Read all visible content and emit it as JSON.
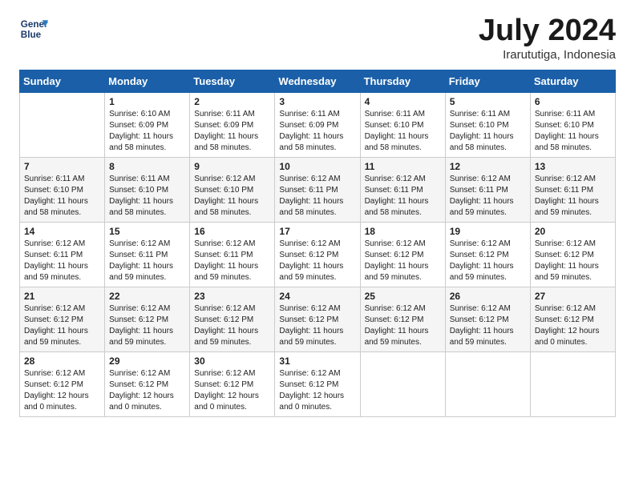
{
  "header": {
    "logo_line1": "General",
    "logo_line2": "Blue",
    "month": "July 2024",
    "location": "Irarututiga, Indonesia"
  },
  "weekdays": [
    "Sunday",
    "Monday",
    "Tuesday",
    "Wednesday",
    "Thursday",
    "Friday",
    "Saturday"
  ],
  "weeks": [
    [
      {
        "num": "",
        "info": ""
      },
      {
        "num": "1",
        "info": "Sunrise: 6:10 AM\nSunset: 6:09 PM\nDaylight: 11 hours\nand 58 minutes."
      },
      {
        "num": "2",
        "info": "Sunrise: 6:11 AM\nSunset: 6:09 PM\nDaylight: 11 hours\nand 58 minutes."
      },
      {
        "num": "3",
        "info": "Sunrise: 6:11 AM\nSunset: 6:09 PM\nDaylight: 11 hours\nand 58 minutes."
      },
      {
        "num": "4",
        "info": "Sunrise: 6:11 AM\nSunset: 6:10 PM\nDaylight: 11 hours\nand 58 minutes."
      },
      {
        "num": "5",
        "info": "Sunrise: 6:11 AM\nSunset: 6:10 PM\nDaylight: 11 hours\nand 58 minutes."
      },
      {
        "num": "6",
        "info": "Sunrise: 6:11 AM\nSunset: 6:10 PM\nDaylight: 11 hours\nand 58 minutes."
      }
    ],
    [
      {
        "num": "7",
        "info": "Sunrise: 6:11 AM\nSunset: 6:10 PM\nDaylight: 11 hours\nand 58 minutes."
      },
      {
        "num": "8",
        "info": "Sunrise: 6:11 AM\nSunset: 6:10 PM\nDaylight: 11 hours\nand 58 minutes."
      },
      {
        "num": "9",
        "info": "Sunrise: 6:12 AM\nSunset: 6:10 PM\nDaylight: 11 hours\nand 58 minutes."
      },
      {
        "num": "10",
        "info": "Sunrise: 6:12 AM\nSunset: 6:11 PM\nDaylight: 11 hours\nand 58 minutes."
      },
      {
        "num": "11",
        "info": "Sunrise: 6:12 AM\nSunset: 6:11 PM\nDaylight: 11 hours\nand 58 minutes."
      },
      {
        "num": "12",
        "info": "Sunrise: 6:12 AM\nSunset: 6:11 PM\nDaylight: 11 hours\nand 59 minutes."
      },
      {
        "num": "13",
        "info": "Sunrise: 6:12 AM\nSunset: 6:11 PM\nDaylight: 11 hours\nand 59 minutes."
      }
    ],
    [
      {
        "num": "14",
        "info": "Sunrise: 6:12 AM\nSunset: 6:11 PM\nDaylight: 11 hours\nand 59 minutes."
      },
      {
        "num": "15",
        "info": "Sunrise: 6:12 AM\nSunset: 6:11 PM\nDaylight: 11 hours\nand 59 minutes."
      },
      {
        "num": "16",
        "info": "Sunrise: 6:12 AM\nSunset: 6:11 PM\nDaylight: 11 hours\nand 59 minutes."
      },
      {
        "num": "17",
        "info": "Sunrise: 6:12 AM\nSunset: 6:12 PM\nDaylight: 11 hours\nand 59 minutes."
      },
      {
        "num": "18",
        "info": "Sunrise: 6:12 AM\nSunset: 6:12 PM\nDaylight: 11 hours\nand 59 minutes."
      },
      {
        "num": "19",
        "info": "Sunrise: 6:12 AM\nSunset: 6:12 PM\nDaylight: 11 hours\nand 59 minutes."
      },
      {
        "num": "20",
        "info": "Sunrise: 6:12 AM\nSunset: 6:12 PM\nDaylight: 11 hours\nand 59 minutes."
      }
    ],
    [
      {
        "num": "21",
        "info": "Sunrise: 6:12 AM\nSunset: 6:12 PM\nDaylight: 11 hours\nand 59 minutes."
      },
      {
        "num": "22",
        "info": "Sunrise: 6:12 AM\nSunset: 6:12 PM\nDaylight: 11 hours\nand 59 minutes."
      },
      {
        "num": "23",
        "info": "Sunrise: 6:12 AM\nSunset: 6:12 PM\nDaylight: 11 hours\nand 59 minutes."
      },
      {
        "num": "24",
        "info": "Sunrise: 6:12 AM\nSunset: 6:12 PM\nDaylight: 11 hours\nand 59 minutes."
      },
      {
        "num": "25",
        "info": "Sunrise: 6:12 AM\nSunset: 6:12 PM\nDaylight: 11 hours\nand 59 minutes."
      },
      {
        "num": "26",
        "info": "Sunrise: 6:12 AM\nSunset: 6:12 PM\nDaylight: 11 hours\nand 59 minutes."
      },
      {
        "num": "27",
        "info": "Sunrise: 6:12 AM\nSunset: 6:12 PM\nDaylight: 12 hours\nand 0 minutes."
      }
    ],
    [
      {
        "num": "28",
        "info": "Sunrise: 6:12 AM\nSunset: 6:12 PM\nDaylight: 12 hours\nand 0 minutes."
      },
      {
        "num": "29",
        "info": "Sunrise: 6:12 AM\nSunset: 6:12 PM\nDaylight: 12 hours\nand 0 minutes."
      },
      {
        "num": "30",
        "info": "Sunrise: 6:12 AM\nSunset: 6:12 PM\nDaylight: 12 hours\nand 0 minutes."
      },
      {
        "num": "31",
        "info": "Sunrise: 6:12 AM\nSunset: 6:12 PM\nDaylight: 12 hours\nand 0 minutes."
      },
      {
        "num": "",
        "info": ""
      },
      {
        "num": "",
        "info": ""
      },
      {
        "num": "",
        "info": ""
      }
    ]
  ]
}
